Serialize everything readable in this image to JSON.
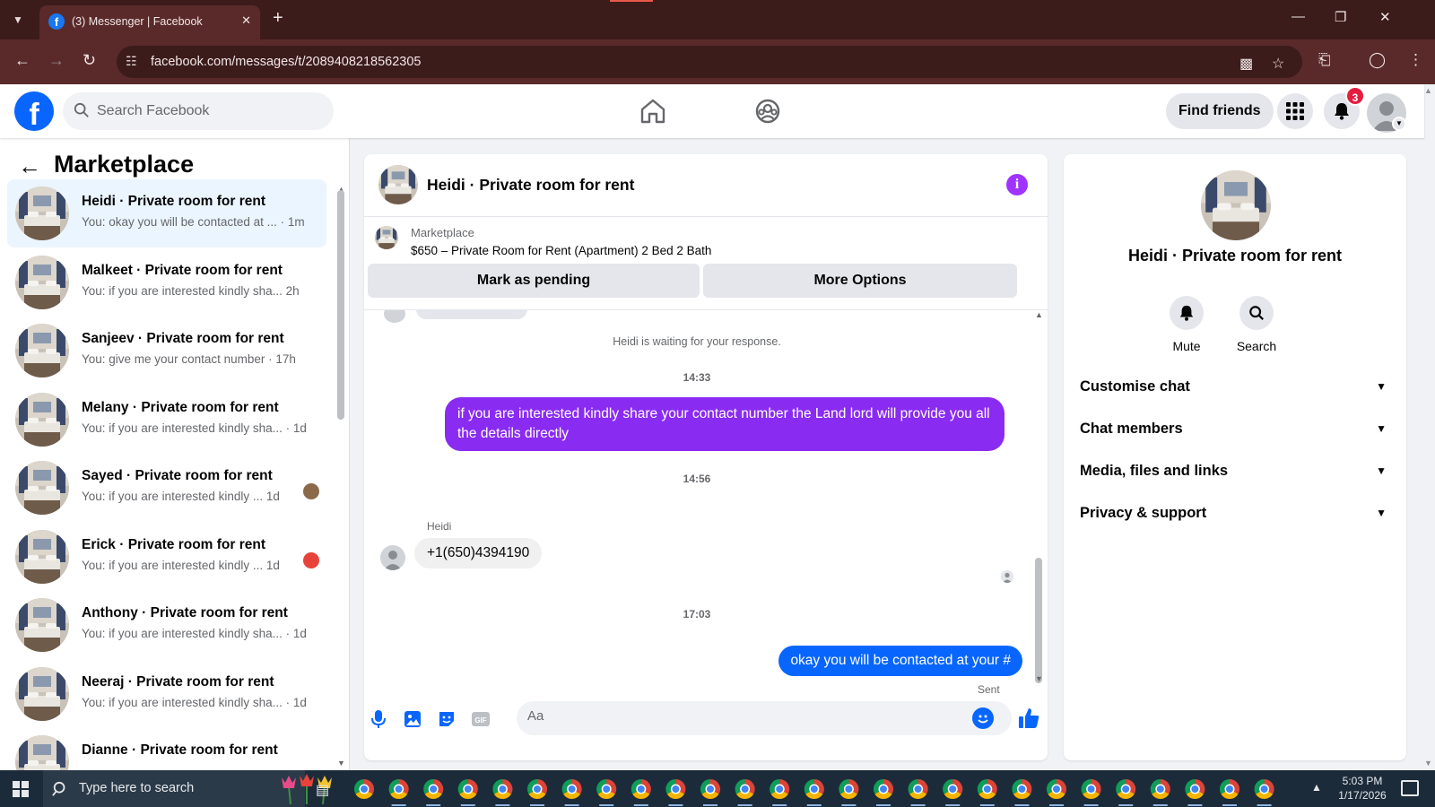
{
  "browser": {
    "tab_title": "(3) Messenger | Facebook",
    "url": "facebook.com/messages/t/2089408218562305",
    "favicon_letter": "f"
  },
  "fb": {
    "logo_letter": "f",
    "search_placeholder": "Search Facebook",
    "find_friends": "Find friends",
    "notification_count": "3"
  },
  "sidebar": {
    "title": "Marketplace",
    "conversations": [
      {
        "name": "Heidi · Private room for rent",
        "preview": "You: okay you will be contacted at ... · 1m",
        "active": true
      },
      {
        "name": "Malkeet · Private room for rent",
        "preview": "You: if you are interested kindly sha... 2h"
      },
      {
        "name": "Sanjeev · Private room for rent",
        "preview": "You: give me your contact number · 17h"
      },
      {
        "name": "Melany · Private room for rent",
        "preview": "You: if you are interested kindly sha... · 1d"
      },
      {
        "name": "Sayed · Private room for rent",
        "preview": "You: if you are interested kindly ...   1d"
      },
      {
        "name": "Erick · Private room for rent",
        "preview": "You: if you are interested kindly ...   1d"
      },
      {
        "name": "Anthony · Private room for rent",
        "preview": "You: if you are interested kindly sha... · 1d"
      },
      {
        "name": "Neeraj · Private room for rent",
        "preview": "You: if you are interested kindly sha... · 1d"
      },
      {
        "name": "Dianne · Private room for rent",
        "preview": ""
      }
    ]
  },
  "chat": {
    "title": "Heidi · Private room for rent",
    "banner_label": "Marketplace",
    "listing": "$650 – Private Room for Rent (Apartment) 2 Bed 2 Bath",
    "mark_pending": "Mark as pending",
    "more_options": "More Options",
    "waiting_text": "Heidi is waiting for your response.",
    "timestamps": [
      "14:33",
      "14:56",
      "17:03"
    ],
    "msg_out_1": "if you are interested kindly share your contact number the Land lord will provide you all the details directly",
    "sender_name": "Heidi",
    "msg_in_1": "+1(650)4394190",
    "msg_out_2": "okay you will be contacted at your #",
    "sent_label": "Sent",
    "composer_placeholder": "Aa"
  },
  "rpanel": {
    "name": "Heidi · Private room for rent",
    "mute": "Mute",
    "search": "Search",
    "rows": [
      "Customise chat",
      "Chat members",
      "Media, files and links",
      "Privacy & support"
    ]
  },
  "taskbar": {
    "search_placeholder": "Type here to search",
    "time": "5:03 PM",
    "date": "1/17/2026"
  },
  "colors": {
    "fb_blue": "#0866ff",
    "messenger_purple": "#8a2bf2",
    "info_purple": "#a033ff",
    "badge_red": "#e41e3f"
  }
}
